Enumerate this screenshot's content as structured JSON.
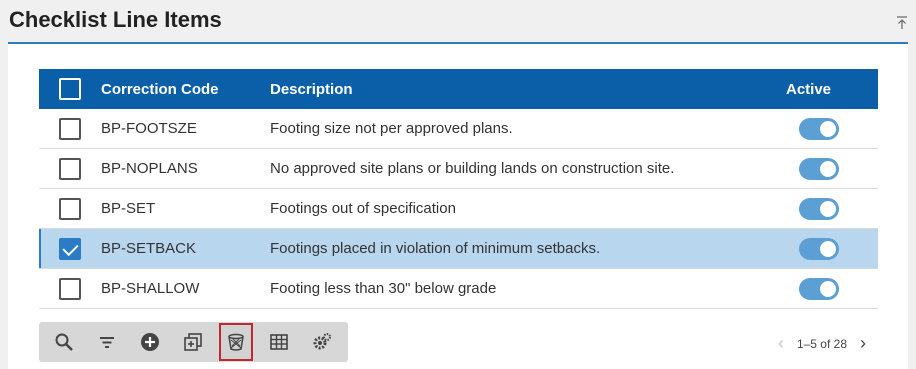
{
  "header": {
    "title": "Checklist Line Items"
  },
  "grid": {
    "columns": {
      "code": "Correction Code",
      "description": "Description",
      "active": "Active"
    },
    "rows": [
      {
        "code": "BP-FOOTSZE",
        "description": "Footing size not per approved plans.",
        "checked": false,
        "active": true
      },
      {
        "code": "BP-NOPLANS",
        "description": "No approved site plans or building lands on construction site.",
        "checked": false,
        "active": true
      },
      {
        "code": "BP-SET",
        "description": "Footings out of specification",
        "checked": false,
        "active": true
      },
      {
        "code": "BP-SETBACK",
        "description": "Footings placed in violation of minimum setbacks.",
        "checked": true,
        "active": true
      },
      {
        "code": "BP-SHALLOW",
        "description": "Footing less than 30\" below grade",
        "checked": false,
        "active": true
      }
    ]
  },
  "toolbar": {
    "buttons": [
      "search-icon",
      "filter-icon",
      "add-icon",
      "copy-icon",
      "delete-icon",
      "grid-icon",
      "settings-icon"
    ],
    "active_button": "delete-icon"
  },
  "pager": {
    "text": "1–5 of 28"
  },
  "colors": {
    "header_bg": "#0b5ea8",
    "accent": "#2b7bc7",
    "selected_row": "#b8d6ee",
    "toggle_on": "#5b9fd4"
  }
}
